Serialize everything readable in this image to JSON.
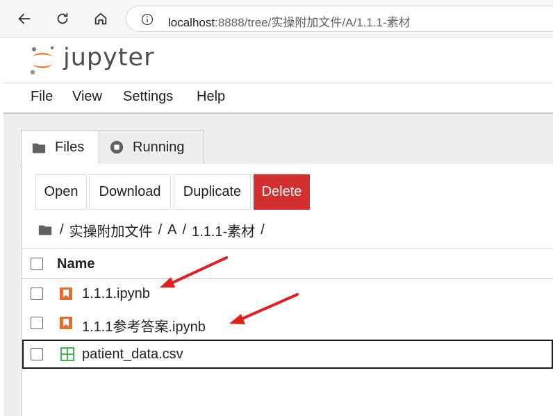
{
  "browser": {
    "url_host": "localhost",
    "url_rest": ":8888/tree/实操附加文件/A/1.1.1-素材"
  },
  "header": {
    "wordmark": "jupyter"
  },
  "menubar": {
    "items": [
      "File",
      "View",
      "Settings",
      "Help"
    ]
  },
  "tabs": [
    {
      "label": "Files",
      "icon": "folder-icon"
    },
    {
      "label": "Running",
      "icon": "stop-circle-icon"
    }
  ],
  "toolbar": {
    "open": "Open",
    "download": "Download",
    "duplicate": "Duplicate",
    "delete": "Delete"
  },
  "breadcrumb": {
    "separator": "/",
    "segments": [
      "实操附加文件",
      "A",
      "1.1.1-素材"
    ]
  },
  "file_list": {
    "header": "Name",
    "files": [
      {
        "name": "1.1.1.ipynb",
        "icon": "notebook-icon",
        "selected": false
      },
      {
        "name": "1.1.1参考答案.ipynb",
        "icon": "notebook-icon",
        "selected": false
      },
      {
        "name": "patient_data.csv",
        "icon": "spreadsheet-icon",
        "selected": true
      }
    ]
  },
  "colors": {
    "delete": "#d32f2f",
    "notebook_icon": "#e46e2e",
    "csv_icon": "#4caf50",
    "annotation_arrow": "#e02020"
  }
}
